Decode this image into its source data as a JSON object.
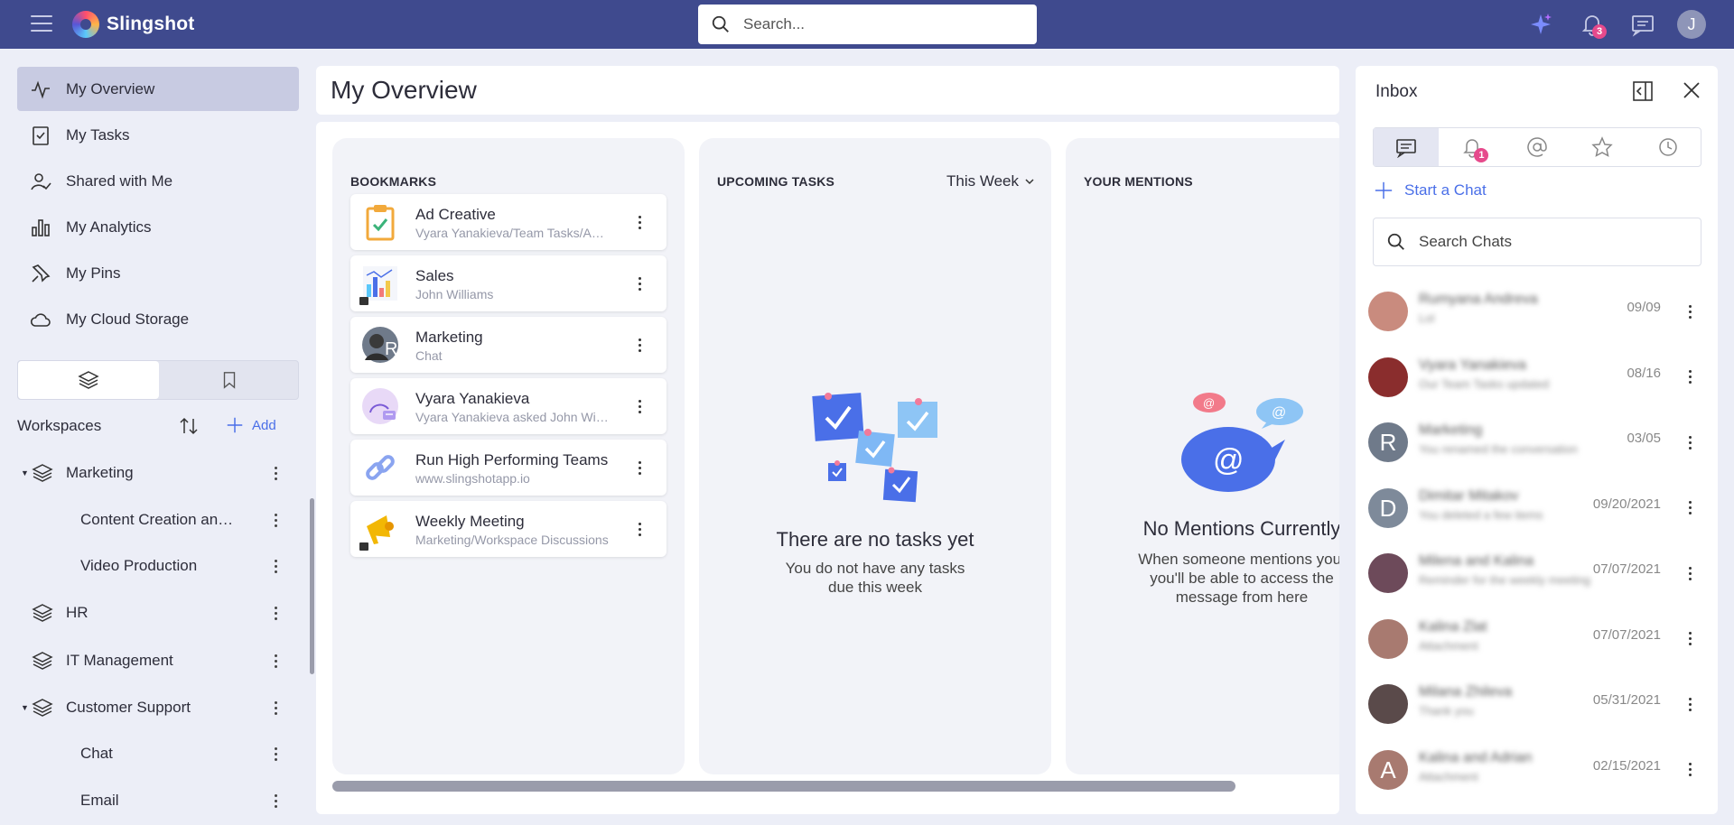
{
  "app": {
    "name": "Slingshot"
  },
  "search": {
    "placeholder": "Search..."
  },
  "notifications": {
    "count": "3"
  },
  "user": {
    "initial": "J"
  },
  "sidebar": {
    "nav": [
      {
        "label": "My Overview",
        "icon": "activity-icon",
        "active": true
      },
      {
        "label": "My Tasks",
        "icon": "task-check-icon"
      },
      {
        "label": "Shared with Me",
        "icon": "user-check-icon"
      },
      {
        "label": "My Analytics",
        "icon": "bar-chart-icon"
      },
      {
        "label": "My Pins",
        "icon": "pin-icon"
      },
      {
        "label": "My Cloud Storage",
        "icon": "cloud-icon"
      }
    ],
    "workspaces_title": "Workspaces",
    "add_label": "Add",
    "workspaces": [
      {
        "label": "Marketing",
        "expanded": true
      },
      {
        "label": "Content Creation and Design",
        "child": true
      },
      {
        "label": "Video Production",
        "child": true
      },
      {
        "label": "HR"
      },
      {
        "label": "IT Management"
      },
      {
        "label": "Customer Support",
        "expanded": true
      },
      {
        "label": "Chat",
        "child": true
      },
      {
        "label": "Email",
        "child": true
      }
    ]
  },
  "main": {
    "title": "My Overview",
    "bookmarks": {
      "title": "BOOKMARKS",
      "items": [
        {
          "title": "Ad Creative",
          "subtitle": "Vyara Yanakieva/Team Tasks/Ad Creative"
        },
        {
          "title": "Sales",
          "subtitle": "John Williams"
        },
        {
          "title": "Marketing",
          "subtitle": "Chat"
        },
        {
          "title": "Vyara Yanakieva",
          "subtitle": "Vyara Yanakieva asked John Williams"
        },
        {
          "title": "Run High Performing Teams",
          "subtitle": "www.slingshotapp.io"
        },
        {
          "title": "Weekly Meeting",
          "subtitle": "Marketing/Workspace Discussions"
        }
      ]
    },
    "tasks": {
      "title": "UPCOMING TASKS",
      "filter": "This Week",
      "empty_title": "There are no tasks yet",
      "empty_sub": "You do not have any tasks due this week"
    },
    "mentions": {
      "title": "YOUR MENTIONS",
      "empty_title": "No Mentions Currently",
      "empty_sub": "When someone mentions you, you'll be able to access the message from here"
    }
  },
  "inbox": {
    "title": "Inbox",
    "mention_badge": "1",
    "start_chat": "Start a Chat",
    "search_placeholder": "Search Chats",
    "chats": [
      {
        "name": "Rumyana Andreva",
        "msg": "Lol",
        "date": "09/09",
        "avatar": "#c98b7e"
      },
      {
        "name": "Vyara Yanakieva",
        "msg": "Our Team Tasks updated",
        "date": "08/16",
        "avatar": "#8a2d2d"
      },
      {
        "name": "Marketing",
        "msg": "You renamed the conversation",
        "date": "03/05",
        "avatar": "#6f7a8a",
        "initial": "R"
      },
      {
        "name": "Dimitar Mitakov",
        "msg": "You deleted a few items",
        "date": "09/20/2021",
        "avatar": "#7e8a9a",
        "initial": "D"
      },
      {
        "name": "Milena and Kalina",
        "msg": "Reminder for the weekly meeting",
        "date": "07/07/2021",
        "avatar": "#6d4a5a"
      },
      {
        "name": "Kalina Zlat",
        "msg": "Attachment",
        "date": "07/07/2021",
        "avatar": "#a87a70"
      },
      {
        "name": "Milana Zhileva",
        "msg": "Thank you",
        "date": "05/31/2021",
        "avatar": "#5a4a4a"
      },
      {
        "name": "Kalina and Adrian",
        "msg": "Attachment",
        "date": "02/15/2021",
        "avatar": "#a87a70",
        "initial": "A"
      }
    ]
  }
}
